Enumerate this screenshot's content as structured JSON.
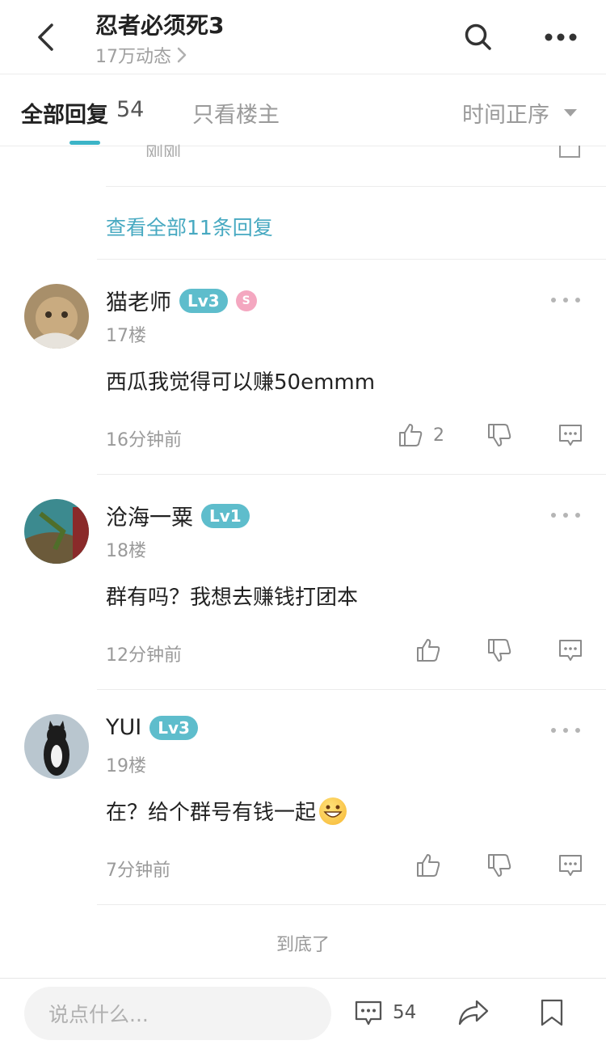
{
  "header": {
    "title": "忍者必须死3",
    "subtitle": "17万动态"
  },
  "tabs": {
    "all_label": "全部回复",
    "all_count": "54",
    "op_only": "只看楼主",
    "sort_label": "时间正序"
  },
  "partial_row": {
    "time": "刚刚"
  },
  "view_all": "查看全部11条回复",
  "comments": [
    {
      "name": "猫老师",
      "level": "Lv3",
      "floor": "17楼",
      "text": "西瓜我觉得可以赚50emmm",
      "time": "16分钟前",
      "likes": "2"
    },
    {
      "name": "沧海一粟",
      "level": "Lv1",
      "floor": "18楼",
      "text": "群有吗？我想去赚钱打团本",
      "time": "12分钟前",
      "likes": ""
    },
    {
      "name": "YUI",
      "level": "Lv3",
      "floor": "19楼",
      "text": "在？给个群号有钱一起",
      "time": "7分钟前",
      "likes": ""
    }
  ],
  "end_text": "到底了",
  "bottom_bar": {
    "input_placeholder": "说点什么...",
    "comment_count": "54"
  },
  "colors": {
    "accent": "#3cb4c7",
    "link": "#47a9c1",
    "level_badge": "#5ebdcc"
  }
}
